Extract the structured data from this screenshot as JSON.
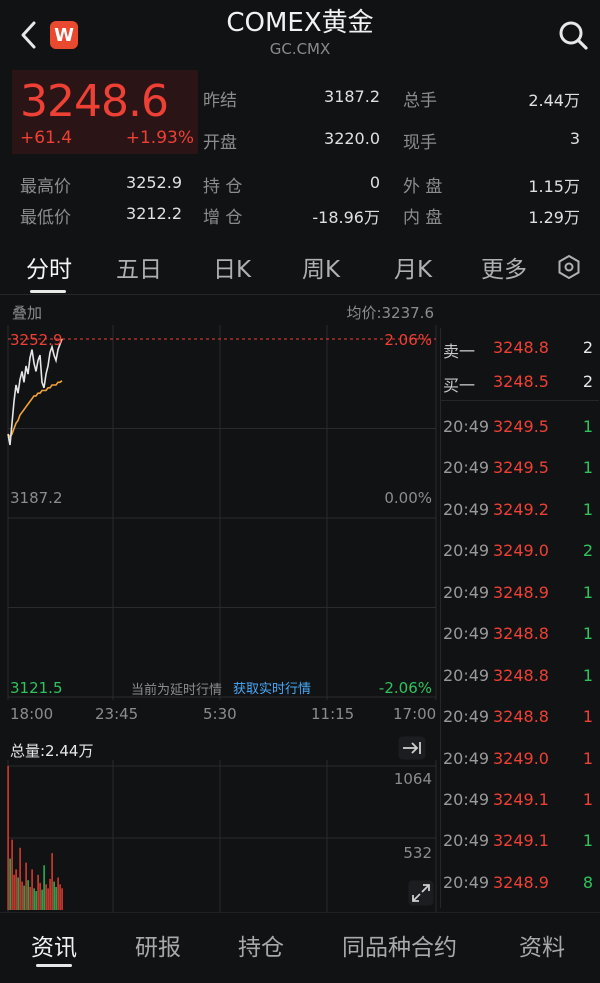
{
  "header": {
    "title": "COMEX黄金",
    "subtitle": "GC.CMX",
    "logo_text": "W"
  },
  "quote": {
    "price": "3248.6",
    "change": "+61.4",
    "change_pct": "+1.93%",
    "prev_close_label": "昨结",
    "prev_close": "3187.2",
    "total_vol_label": "总手",
    "total_vol": "2.44万",
    "open_label": "开盘",
    "open": "3220.0",
    "current_vol_label": "现手",
    "current_vol": "3",
    "high_label": "最高价",
    "high": "3252.9",
    "low_label": "最低价",
    "low": "3212.2",
    "position_label": "持 仓",
    "position": "0",
    "position_change_label": "增 仓",
    "position_change": "-18.96万",
    "outer_label": "外 盘",
    "outer": "1.15万",
    "inner_label": "内 盘",
    "inner": "1.29万"
  },
  "tabs": [
    "分时",
    "五日",
    "日K",
    "周K",
    "月K",
    "更多"
  ],
  "chart": {
    "overlay_label": "叠加",
    "avg_label": "均价:3237.6",
    "top_price": "3252.9",
    "top_pct": "2.06%",
    "mid_price": "3187.2",
    "mid_pct": "0.00%",
    "bottom_price": "3121.5",
    "bottom_pct": "-2.06%",
    "delayed_text": "当前为延时行情",
    "realtime_link": "获取实时行情",
    "time_labels": [
      "18:00",
      "23:45",
      "5:30",
      "11:15",
      "17:00"
    ],
    "total_volume_label": "总量:2.44万",
    "vol_max": "1064",
    "vol_mid": "532"
  },
  "chart_data": {
    "type": "line",
    "title": "",
    "ylim": [
      3121.5,
      3252.9
    ],
    "reference": 3187.2,
    "x": [
      0,
      1,
      2,
      3,
      4,
      5,
      6,
      7,
      8,
      9,
      10,
      11,
      12,
      13,
      14,
      15,
      16,
      17,
      18,
      19,
      20,
      21,
      22,
      23,
      24,
      25,
      26,
      27
    ],
    "series": [
      {
        "values": [
          3218,
          3214,
          3222,
          3230,
          3236,
          3233,
          3238,
          3241,
          3237,
          3243,
          3240,
          3246,
          3249,
          3244,
          3241,
          3245,
          3247,
          3237,
          3235,
          3240,
          3243,
          3248,
          3250,
          3247,
          3245,
          3249,
          3251,
          3252.9
        ]
      },
      {
        "values": [
          3218,
          3217,
          3218,
          3220,
          3222,
          3223,
          3225,
          3226,
          3227,
          3228,
          3229,
          3230,
          3231,
          3232,
          3232,
          3233,
          3233,
          3234,
          3234,
          3234,
          3235,
          3235,
          3236,
          3236,
          3236,
          3237,
          3237,
          3237.6
        ]
      }
    ],
    "volume": [
      1064,
      380,
      520,
      260,
      300,
      240,
      460,
      210,
      180,
      350,
      220,
      170,
      300,
      160,
      140,
      260,
      200,
      150,
      330,
      190,
      160,
      230,
      420,
      210,
      170,
      240,
      190,
      160
    ]
  },
  "order_book": [
    {
      "label": "卖一",
      "price": "3248.8",
      "qty": "2"
    },
    {
      "label": "买一",
      "price": "3248.5",
      "qty": "2"
    }
  ],
  "trades": [
    {
      "time": "20:49",
      "price": "3249.5",
      "qty": "1"
    },
    {
      "time": "20:49",
      "price": "3249.5",
      "qty": "1"
    },
    {
      "time": "20:49",
      "price": "3249.2",
      "qty": "1"
    },
    {
      "time": "20:49",
      "price": "3249.0",
      "qty": "2"
    },
    {
      "time": "20:49",
      "price": "3248.9",
      "qty": "1"
    },
    {
      "time": "20:49",
      "price": "3248.8",
      "qty": "1"
    },
    {
      "time": "20:49",
      "price": "3248.8",
      "qty": "1"
    },
    {
      "time": "20:49",
      "price": "3248.8",
      "qty": "1"
    },
    {
      "time": "20:49",
      "price": "3249.0",
      "qty": "1"
    },
    {
      "time": "20:49",
      "price": "3249.1",
      "qty": "1"
    },
    {
      "time": "20:49",
      "price": "3249.1",
      "qty": "1"
    },
    {
      "time": "20:49",
      "price": "3248.9",
      "qty": "8"
    }
  ],
  "bottom_nav": [
    "资讯",
    "研报",
    "持仓",
    "同品种合约",
    "资料"
  ],
  "colors": {
    "up": "#ee4035",
    "down": "#2fc35b",
    "avg_line": "#f0a33a",
    "price_line": "#e6e6e6"
  }
}
